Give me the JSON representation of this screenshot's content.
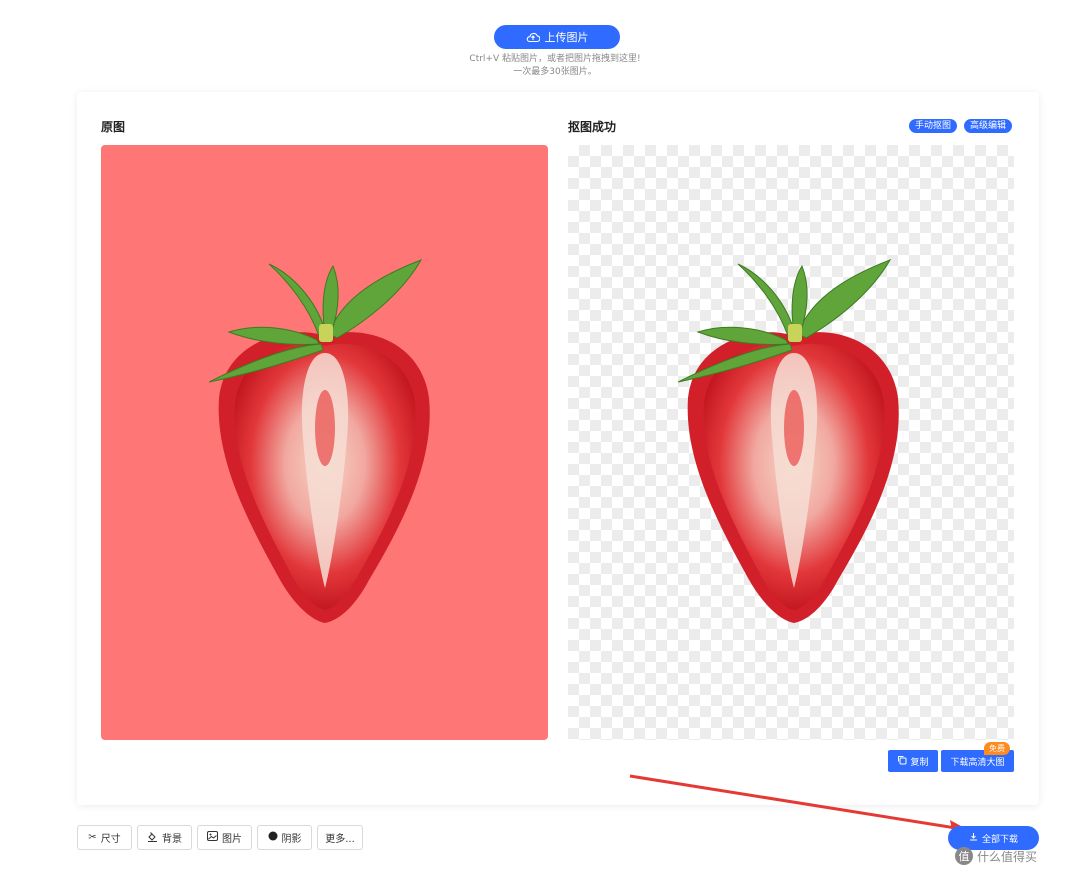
{
  "upload": {
    "button_label": "上传图片",
    "hint_line1": "Ctrl+V 粘贴图片，或者把图片拖拽到这里!",
    "hint_line2": "一次最多30张图片。"
  },
  "original": {
    "title": "原图",
    "background_color": "#ff7676"
  },
  "result": {
    "title": "抠图成功",
    "tags": [
      "手动抠图",
      "高级编辑"
    ],
    "copy_label": "复制",
    "download_hd_label": "下载高清大图",
    "free_badge": "免费"
  },
  "toolbar": {
    "items": [
      {
        "label": "尺寸",
        "icon": "scissors-icon"
      },
      {
        "label": "背景",
        "icon": "paint-bucket-icon"
      },
      {
        "label": "图片",
        "icon": "image-icon"
      },
      {
        "label": "阴影",
        "icon": "shadow-icon"
      },
      {
        "label": "更多..."
      }
    ],
    "download_all_label": "全部下载"
  },
  "watermark": {
    "text": "什么值得买",
    "logo": "值"
  },
  "colors": {
    "accent": "#2f6bff",
    "badge": "#ff8a1f",
    "arrow": "#e53935"
  }
}
